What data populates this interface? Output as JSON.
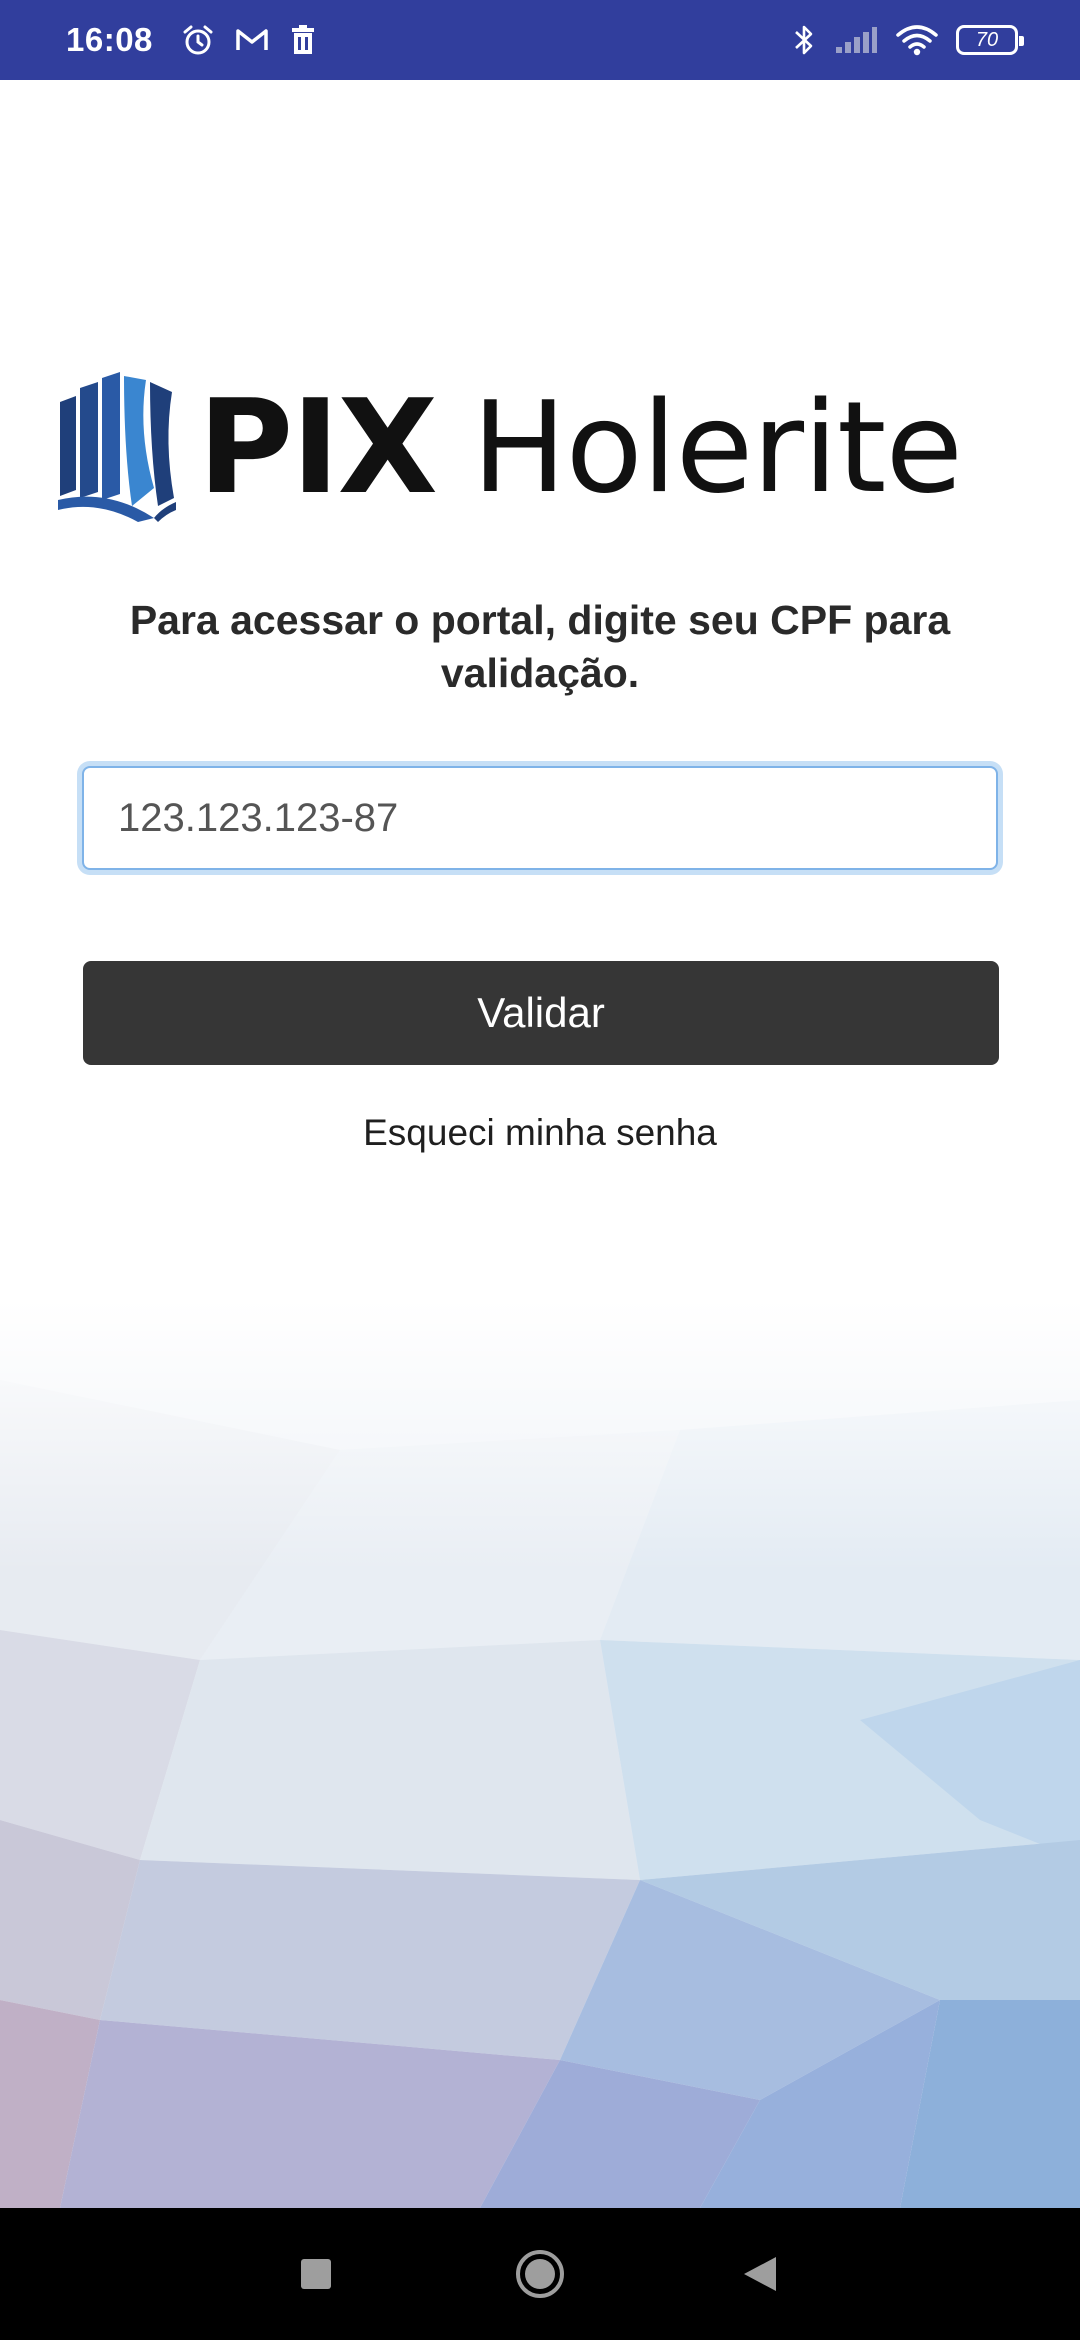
{
  "status_bar": {
    "time": "16:08",
    "battery_level": "70",
    "icons": [
      "alarm-icon",
      "gmail-icon",
      "trash-icon",
      "bluetooth-icon",
      "signal-icon",
      "wifi-icon",
      "battery-icon"
    ],
    "background_color": "#313e9d"
  },
  "logo": {
    "brand": "PIX",
    "product": "Holerite",
    "icon": "book-logo-icon"
  },
  "form": {
    "instruction": "Para acessar o portal, digite seu CPF para validação.",
    "cpf_value": "123.123.123-87",
    "validate_label": "Validar",
    "forgot_label": "Esqueci minha senha"
  },
  "colors": {
    "button": "#363636",
    "input_focus": "#7fb3e8",
    "logo_dark_blue": "#1f3f7a",
    "logo_light_blue": "#3a86d0"
  },
  "nav_bar": {
    "icons": [
      "recent-apps-icon",
      "home-icon",
      "back-icon"
    ]
  }
}
